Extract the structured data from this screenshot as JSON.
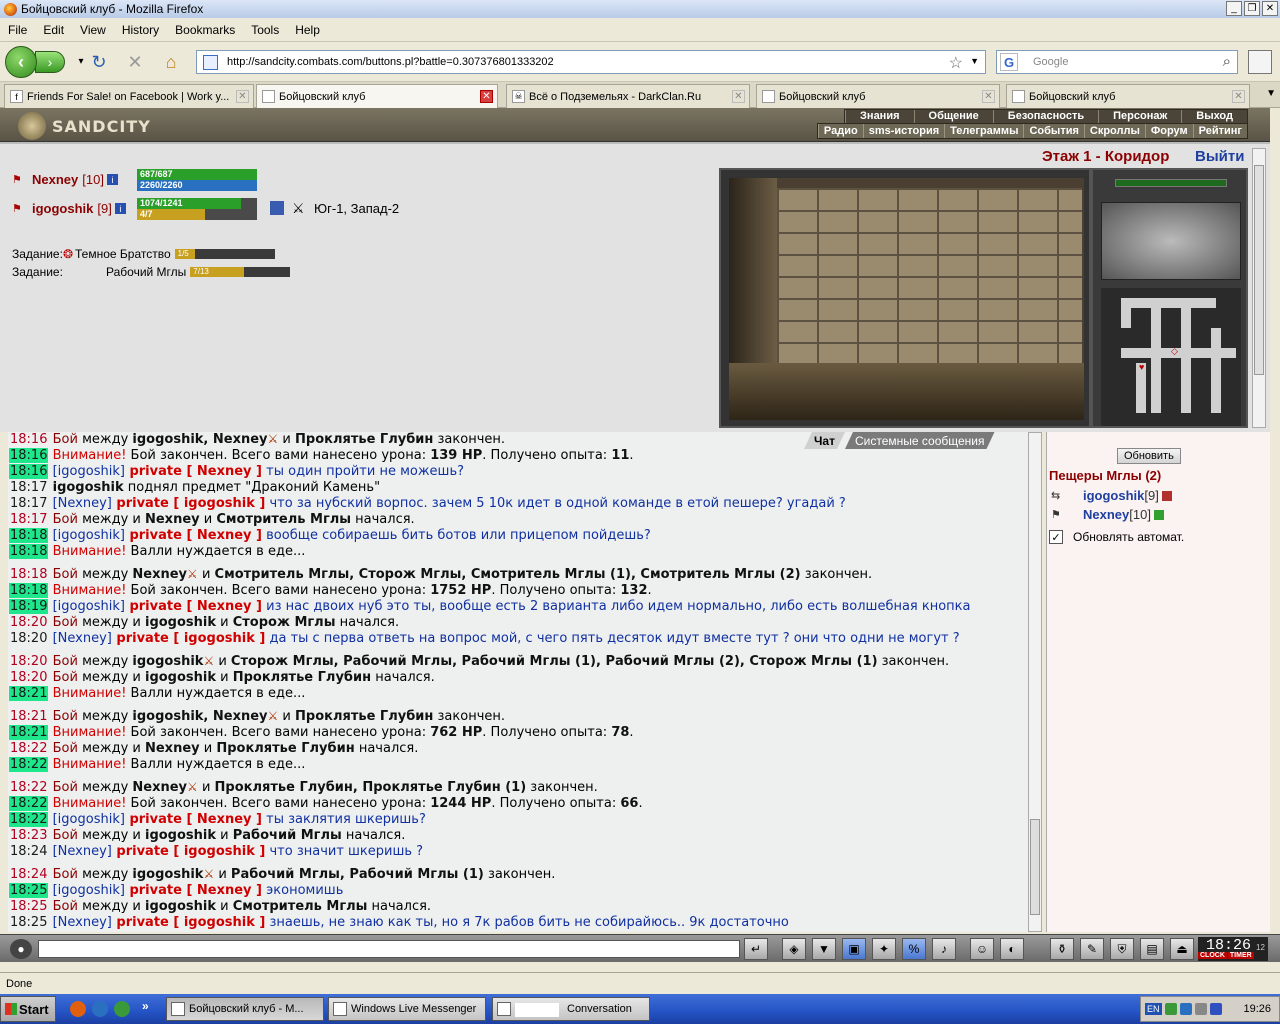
{
  "window": {
    "title": "Бойцовский клуб - Mozilla Firefox"
  },
  "menu": [
    "File",
    "Edit",
    "View",
    "History",
    "Bookmarks",
    "Tools",
    "Help"
  ],
  "nav": {
    "url": "http://sandcity.combats.com/buttons.pl?battle=0.307376801333202",
    "search_placeholder": "Google"
  },
  "tabs": [
    {
      "label": "Friends For Sale! on Facebook | Work y...",
      "icon": "facebook-icon",
      "active": false
    },
    {
      "label": "Бойцовский клуб",
      "icon": "page-icon",
      "active": true
    },
    {
      "label": "Всё о Подземельях - DarkClan.Ru",
      "icon": "skull-icon",
      "active": false
    },
    {
      "label": "Бойцовский клуб",
      "icon": "page-icon",
      "active": false
    },
    {
      "label": "Бойцовский клуб",
      "icon": "page-icon",
      "active": false
    }
  ],
  "game": {
    "logo": "SANDCITY",
    "nav_top": [
      "Знания",
      "Общение",
      "Безопасность",
      "Персонаж",
      "Выход"
    ],
    "nav_bottom": [
      "Радио",
      "sms-история",
      "Телеграммы",
      "События",
      "Скроллы",
      "Форум",
      "Рейтинг"
    ],
    "characters": [
      {
        "name": "Nexney",
        "level": "[10]",
        "hp": "687/687",
        "hp_fraction": 1.0,
        "mana": "2260/2260",
        "mana_fraction": 1.0
      },
      {
        "name": "igogoshik",
        "level": "[9]",
        "hp": "1074/1241",
        "hp_fraction": 0.865,
        "mana": "4/7",
        "mana_fraction": 0.57
      }
    ],
    "location": "Юг-1, Запад-2",
    "tasks": [
      {
        "label": "Задание:",
        "name": "Темное Братство",
        "progress": "1/5",
        "fraction": 0.2
      },
      {
        "label": "Задание:",
        "name": "Рабочий Мглы",
        "progress": "7/13",
        "fraction": 0.54
      }
    ],
    "floor": "Этаж 1 - Коридор",
    "exit": "Выйти"
  },
  "chat": {
    "tabs": [
      "Чат",
      "Системные сообщения"
    ],
    "lines": [
      {
        "time": "18:16",
        "hl": false,
        "parts": [
          [
            "sys",
            "Бой"
          ],
          [
            "t",
            " между "
          ],
          [
            "nm",
            "igogoshik, Nexney"
          ],
          [
            "atk",
            "⚔"
          ],
          [
            "t",
            " и "
          ],
          [
            "nm",
            "Проклятье Глубин"
          ],
          [
            "t",
            " закончен."
          ]
        ]
      },
      {
        "time": "18:16",
        "hl": true,
        "parts": [
          [
            "warn",
            "Внимание!"
          ],
          [
            "t",
            " Бой закончен. Всего вами нанесено урона: "
          ],
          [
            "nm",
            "139 HP"
          ],
          [
            "t",
            ". Получено опыта: "
          ],
          [
            "nm",
            "11"
          ],
          [
            "t",
            "."
          ]
        ]
      },
      {
        "time": "18:16",
        "hl": true,
        "parts": [
          [
            "br",
            "[igogoshik]"
          ],
          [
            "priv",
            " private [ Nexney ]"
          ],
          [
            "pm",
            " ты один пройти не можешь?"
          ]
        ]
      },
      {
        "time": "18:17",
        "hl": false,
        "parts": [
          [
            "nm",
            "igogoshik"
          ],
          [
            "t",
            " поднял предмет \"Драконий Камень\""
          ]
        ]
      },
      {
        "time": "18:17",
        "hl": false,
        "parts": [
          [
            "br",
            "[Nexney]"
          ],
          [
            "priv",
            " private [ igogoshik ]"
          ],
          [
            "pm",
            " что за нубский ворпос. зачем 5 10к идет в одной команде в етой пешере? угадай ?"
          ]
        ]
      },
      {
        "time": "18:17",
        "hl": false,
        "parts": [
          [
            "sys",
            "Бой"
          ],
          [
            "t",
            " между  и "
          ],
          [
            "nm",
            "Nexney"
          ],
          [
            "t",
            " и "
          ],
          [
            "nm",
            "Смотритель Мглы"
          ],
          [
            "t",
            " начался."
          ]
        ]
      },
      {
        "time": "18:18",
        "hl": true,
        "parts": [
          [
            "br",
            "[igogoshik]"
          ],
          [
            "priv",
            " private [ Nexney ]"
          ],
          [
            "pm",
            " вообще собираешь бить ботов или прицепом пойдешь?"
          ]
        ]
      },
      {
        "time": "18:18",
        "hl": true,
        "parts": [
          [
            "warn",
            "Внимание!"
          ],
          [
            "t",
            " Валли нуждается в еде..."
          ]
        ]
      },
      {
        "time": "18:18",
        "hl": false,
        "gap": true,
        "parts": [
          [
            "sys",
            "Бой"
          ],
          [
            "t",
            " между "
          ],
          [
            "nm",
            "Nexney"
          ],
          [
            "atk",
            "⚔"
          ],
          [
            "t",
            " и "
          ],
          [
            "nm",
            "Смотритель Мглы, Сторож Мглы, Смотритель Мглы (1), Смотритель Мглы (2)"
          ],
          [
            "t",
            " закончен."
          ]
        ]
      },
      {
        "time": "18:18",
        "hl": true,
        "parts": [
          [
            "warn",
            "Внимание!"
          ],
          [
            "t",
            " Бой закончен. Всего вами нанесено урона: "
          ],
          [
            "nm",
            "1752 HP"
          ],
          [
            "t",
            ". Получено опыта: "
          ],
          [
            "nm",
            "132"
          ],
          [
            "t",
            "."
          ]
        ]
      },
      {
        "time": "18:19",
        "hl": true,
        "parts": [
          [
            "br",
            "[igogoshik]"
          ],
          [
            "priv",
            " private [ Nexney ]"
          ],
          [
            "pm",
            " из нас двоих нуб это ты, вообще есть 2 варианта либо идем нормально, либо есть волшебная кнопка"
          ]
        ]
      },
      {
        "time": "18:20",
        "hl": false,
        "parts": [
          [
            "sys",
            "Бой"
          ],
          [
            "t",
            " между  и "
          ],
          [
            "nm",
            "igogoshik"
          ],
          [
            "t",
            " и "
          ],
          [
            "nm",
            "Сторож Мглы"
          ],
          [
            "t",
            " начался."
          ]
        ]
      },
      {
        "time": "18:20",
        "hl": false,
        "parts": [
          [
            "br",
            "[Nexney]"
          ],
          [
            "priv",
            " private [ igogoshik ]"
          ],
          [
            "pm",
            " да ты с перва ответь на вопрос мой, с чего пять десяток идут вместе тут ? они что одни не могут ?"
          ]
        ]
      },
      {
        "time": "18:20",
        "hl": false,
        "gap": true,
        "parts": [
          [
            "sys",
            "Бой"
          ],
          [
            "t",
            " между "
          ],
          [
            "nm",
            "igogoshik"
          ],
          [
            "atk",
            "⚔"
          ],
          [
            "t",
            " и "
          ],
          [
            "nm",
            "Сторож Мглы, Рабочий Мглы, Рабочий Мглы (1), Рабочий Мглы (2), Сторож Мглы (1)"
          ],
          [
            "t",
            " закончен."
          ]
        ]
      },
      {
        "time": "18:20",
        "hl": false,
        "parts": [
          [
            "sys",
            "Бой"
          ],
          [
            "t",
            " между  и "
          ],
          [
            "nm",
            "igogoshik"
          ],
          [
            "t",
            " и "
          ],
          [
            "nm",
            "Проклятье Глубин"
          ],
          [
            "t",
            " начался."
          ]
        ]
      },
      {
        "time": "18:21",
        "hl": true,
        "parts": [
          [
            "warn",
            "Внимание!"
          ],
          [
            "t",
            " Валли нуждается в еде..."
          ]
        ]
      },
      {
        "time": "18:21",
        "hl": false,
        "gap": true,
        "parts": [
          [
            "sys",
            "Бой"
          ],
          [
            "t",
            " между "
          ],
          [
            "nm",
            "igogoshik, Nexney"
          ],
          [
            "atk",
            "⚔"
          ],
          [
            "t",
            " и "
          ],
          [
            "nm",
            "Проклятье Глубин"
          ],
          [
            "t",
            " закончен."
          ]
        ]
      },
      {
        "time": "18:21",
        "hl": true,
        "parts": [
          [
            "warn",
            "Внимание!"
          ],
          [
            "t",
            " Бой закончен. Всего вами нанесено урона: "
          ],
          [
            "nm",
            "762 HP"
          ],
          [
            "t",
            ". Получено опыта: "
          ],
          [
            "nm",
            "78"
          ],
          [
            "t",
            "."
          ]
        ]
      },
      {
        "time": "18:22",
        "hl": false,
        "parts": [
          [
            "sys",
            "Бой"
          ],
          [
            "t",
            " между  и "
          ],
          [
            "nm",
            "Nexney"
          ],
          [
            "t",
            " и "
          ],
          [
            "nm",
            "Проклятье Глубин"
          ],
          [
            "t",
            " начался."
          ]
        ]
      },
      {
        "time": "18:22",
        "hl": true,
        "parts": [
          [
            "warn",
            "Внимание!"
          ],
          [
            "t",
            " Валли нуждается в еде..."
          ]
        ]
      },
      {
        "time": "18:22",
        "hl": false,
        "gap": true,
        "parts": [
          [
            "sys",
            "Бой"
          ],
          [
            "t",
            " между "
          ],
          [
            "nm",
            "Nexney"
          ],
          [
            "atk",
            "⚔"
          ],
          [
            "t",
            " и "
          ],
          [
            "nm",
            "Проклятье Глубин, Проклятье Глубин (1)"
          ],
          [
            "t",
            " закончен."
          ]
        ]
      },
      {
        "time": "18:22",
        "hl": true,
        "parts": [
          [
            "warn",
            "Внимание!"
          ],
          [
            "t",
            " Бой закончен. Всего вами нанесено урона: "
          ],
          [
            "nm",
            "1244 HP"
          ],
          [
            "t",
            ". Получено опыта: "
          ],
          [
            "nm",
            "66"
          ],
          [
            "t",
            "."
          ]
        ]
      },
      {
        "time": "18:22",
        "hl": true,
        "parts": [
          [
            "br",
            "[igogoshik]"
          ],
          [
            "priv",
            " private [ Nexney ]"
          ],
          [
            "pm",
            " ты заклятия шкеришь?"
          ]
        ]
      },
      {
        "time": "18:23",
        "hl": false,
        "parts": [
          [
            "sys",
            "Бой"
          ],
          [
            "t",
            " между  и "
          ],
          [
            "nm",
            "igogoshik"
          ],
          [
            "t",
            " и "
          ],
          [
            "nm",
            "Рабочий Мглы"
          ],
          [
            "t",
            " начался."
          ]
        ]
      },
      {
        "time": "18:24",
        "hl": false,
        "parts": [
          [
            "br",
            "[Nexney]"
          ],
          [
            "priv",
            " private [ igogoshik ]"
          ],
          [
            "pm",
            " что значит шкеришь ?"
          ]
        ]
      },
      {
        "time": "18:24",
        "hl": false,
        "gap": true,
        "parts": [
          [
            "sys",
            "Бой"
          ],
          [
            "t",
            " между "
          ],
          [
            "nm",
            "igogoshik"
          ],
          [
            "atk",
            "⚔"
          ],
          [
            "t",
            " и "
          ],
          [
            "nm",
            "Рабочий Мглы, Рабочий Мглы (1)"
          ],
          [
            "t",
            " закончен."
          ]
        ]
      },
      {
        "time": "18:25",
        "hl": true,
        "parts": [
          [
            "br",
            "[igogoshik]"
          ],
          [
            "priv",
            " private [ Nexney ]"
          ],
          [
            "pm",
            " экономишь"
          ]
        ]
      },
      {
        "time": "18:25",
        "hl": false,
        "parts": [
          [
            "sys",
            "Бой"
          ],
          [
            "t",
            " между  и "
          ],
          [
            "nm",
            "igogoshik"
          ],
          [
            "t",
            " и "
          ],
          [
            "nm",
            "Смотритель Мглы"
          ],
          [
            "t",
            " начался."
          ]
        ]
      },
      {
        "time": "18:25",
        "hl": false,
        "parts": [
          [
            "br",
            "[Nexney]"
          ],
          [
            "priv",
            " private [ igogoshik ]"
          ],
          [
            "pm",
            " знаешь, не знаю как ты, но я 7к рабов бить не собирайюсь.. 9к достаточно"
          ]
        ]
      }
    ]
  },
  "room": {
    "refresh_label": "Обновить",
    "name": "Пещеры Мглы (2)",
    "players": [
      {
        "name": "igogoshik",
        "level": "[9]"
      },
      {
        "name": "Nexney",
        "level": "[10]"
      }
    ],
    "auto_label": "Обновлять автомат."
  },
  "toolbar": {
    "clock": "18:26",
    "clock_sec": "12",
    "clock_labels": [
      "CLOCK",
      "TIMER"
    ]
  },
  "status": {
    "text": "Done"
  },
  "taskbar": {
    "start": "Start",
    "buttons": [
      "Бойцовский клуб - M...",
      "Windows Live Messenger",
      "Conversation"
    ],
    "lang": "EN",
    "time": "19:26"
  },
  "colors": {
    "accent_green": "#1ee68a",
    "name_red": "#8b0000",
    "private_red": "#d00000",
    "msg_blue": "#1030a0"
  }
}
